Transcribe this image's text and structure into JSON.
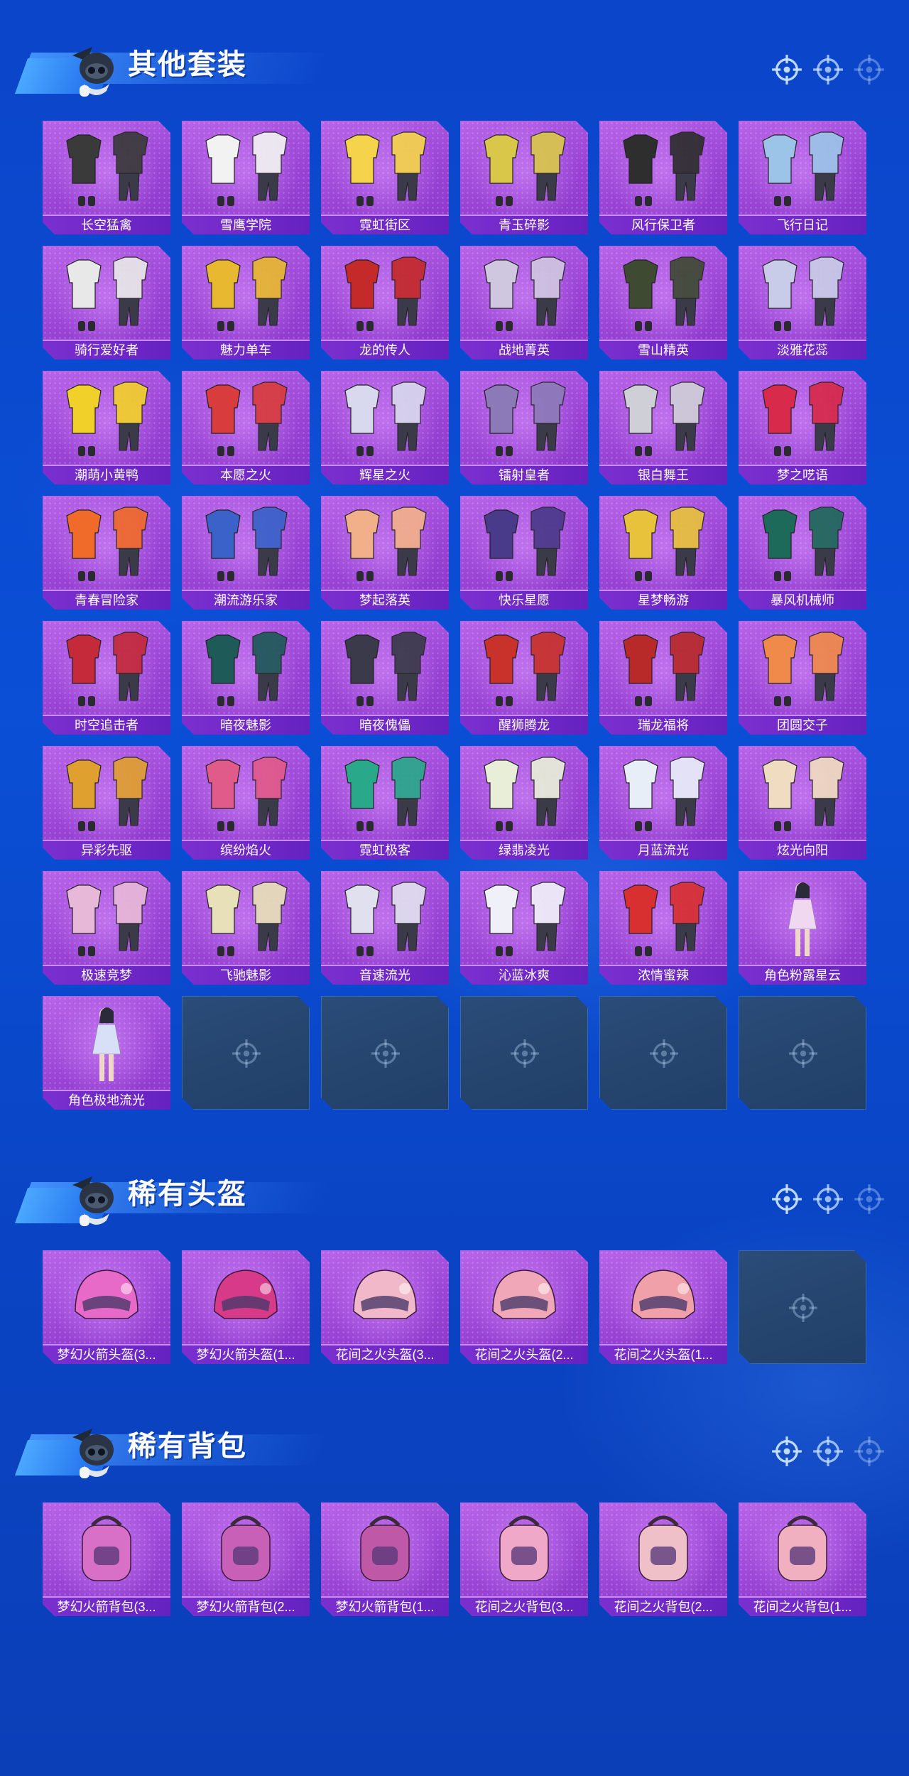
{
  "colors": {
    "background": "#0b45c9",
    "tile_purple": "#9a44d6",
    "label_purple": "#6522c0",
    "empty_tile": "#24436e"
  },
  "sections": [
    {
      "title": "其他套装",
      "items": [
        {
          "label": "长空猛禽",
          "icon": "outfit-icon",
          "art": "#3a3a3a"
        },
        {
          "label": "雪鹰学院",
          "icon": "outfit-icon",
          "art": "#f2f2f2"
        },
        {
          "label": "霓虹街区",
          "icon": "outfit-icon",
          "art": "#f5d34a"
        },
        {
          "label": "青玉碎影",
          "icon": "outfit-icon",
          "art": "#d9c74a"
        },
        {
          "label": "风行保卫者",
          "icon": "outfit-icon",
          "art": "#2e2e2e"
        },
        {
          "label": "飞行日记",
          "icon": "outfit-icon",
          "art": "#9cc4e8"
        },
        {
          "label": "骑行爱好者",
          "icon": "outfit-icon",
          "art": "#e8e8e8"
        },
        {
          "label": "魅力单车",
          "icon": "outfit-icon",
          "art": "#e8b830"
        },
        {
          "label": "龙的传人",
          "icon": "outfit-icon",
          "art": "#c42a2a"
        },
        {
          "label": "战地菁英",
          "icon": "outfit-icon",
          "art": "#cfc6e0"
        },
        {
          "label": "雪山精英",
          "icon": "outfit-icon",
          "art": "#3e4a32"
        },
        {
          "label": "淡雅花蕊",
          "icon": "outfit-icon",
          "art": "#c8cce8"
        },
        {
          "label": "潮萌小黄鸭",
          "icon": "outfit-icon",
          "art": "#f2d02a"
        },
        {
          "label": "本愿之火",
          "icon": "outfit-icon",
          "art": "#d83c3c"
        },
        {
          "label": "辉星之火",
          "icon": "outfit-icon",
          "art": "#d8d8ee"
        },
        {
          "label": "镭射皇者",
          "icon": "outfit-icon",
          "art": "#8c7ab8"
        },
        {
          "label": "银白舞王",
          "icon": "outfit-icon",
          "art": "#cfcfd8"
        },
        {
          "label": "梦之呓语",
          "icon": "outfit-icon",
          "art": "#d82a4a"
        },
        {
          "label": "青春冒险家",
          "icon": "outfit-icon",
          "art": "#f06a2a"
        },
        {
          "label": "潮流游乐家",
          "icon": "outfit-icon",
          "art": "#3a62c8"
        },
        {
          "label": "梦起落英",
          "icon": "outfit-icon",
          "art": "#f2b08a"
        },
        {
          "label": "快乐星愿",
          "icon": "outfit-icon",
          "art": "#4a3a8a"
        },
        {
          "label": "星梦畅游",
          "icon": "outfit-icon",
          "art": "#e8c23a"
        },
        {
          "label": "暴风机械师",
          "icon": "outfit-icon",
          "art": "#1e6a5a"
        },
        {
          "label": "时空追击者",
          "icon": "outfit-icon",
          "art": "#c42a3a"
        },
        {
          "label": "暗夜魅影",
          "icon": "outfit-icon",
          "art": "#1e5a58"
        },
        {
          "label": "暗夜傀儡",
          "icon": "outfit-icon",
          "art": "#3a3a4a"
        },
        {
          "label": "醒狮腾龙",
          "icon": "outfit-icon",
          "art": "#c8322a"
        },
        {
          "label": "瑞龙福将",
          "icon": "outfit-icon",
          "art": "#b82a2a"
        },
        {
          "label": "团圆交子",
          "icon": "outfit-icon",
          "art": "#f08a4a"
        },
        {
          "label": "异彩先驱",
          "icon": "outfit-icon",
          "art": "#e0a030"
        },
        {
          "label": "缤纷焰火",
          "icon": "outfit-icon",
          "art": "#e05a8a"
        },
        {
          "label": "霓虹极客",
          "icon": "outfit-icon",
          "art": "#2aa88a"
        },
        {
          "label": "绿翡凌光",
          "icon": "outfit-icon",
          "art": "#e8eed8"
        },
        {
          "label": "月蓝流光",
          "icon": "outfit-icon",
          "art": "#e8eef8"
        },
        {
          "label": "炫光向阳",
          "icon": "outfit-icon",
          "art": "#f0dcc0"
        },
        {
          "label": "极速竞梦",
          "icon": "outfit-icon",
          "art": "#e8b8d8"
        },
        {
          "label": "飞驰魅影",
          "icon": "outfit-icon",
          "art": "#e8e0b8"
        },
        {
          "label": "音速流光",
          "icon": "outfit-icon",
          "art": "#e0e0ee"
        },
        {
          "label": "沁蓝冰爽",
          "icon": "outfit-icon",
          "art": "#f0f0f8"
        },
        {
          "label": "浓情蜜辣",
          "icon": "outfit-icon",
          "art": "#d83030"
        },
        {
          "label": "角色粉露星云",
          "icon": "character-icon",
          "art": "#f0d8f0"
        },
        {
          "label": "角色极地流光",
          "icon": "character-icon",
          "art": "#d8e0f8"
        },
        null,
        null,
        null,
        null,
        null
      ]
    },
    {
      "title": "稀有头盔",
      "items": [
        {
          "label": "梦幻火箭头盔(3...",
          "icon": "helmet-icon",
          "art": "#e86ac8"
        },
        {
          "label": "梦幻火箭头盔(1...",
          "icon": "helmet-icon",
          "art": "#d83a8a"
        },
        {
          "label": "花间之火头盔(3...",
          "icon": "helmet-icon",
          "art": "#f0b8c8"
        },
        {
          "label": "花间之火头盔(2...",
          "icon": "helmet-icon",
          "art": "#f0a8b8"
        },
        {
          "label": "花间之火头盔(1...",
          "icon": "helmet-icon",
          "art": "#f0a0a8"
        },
        null
      ]
    },
    {
      "title": "稀有背包",
      "items": [
        {
          "label": "梦幻火箭背包(3...",
          "icon": "backpack-icon",
          "art": "#d870c8"
        },
        {
          "label": "梦幻火箭背包(2...",
          "icon": "backpack-icon",
          "art": "#c860b8"
        },
        {
          "label": "梦幻火箭背包(1...",
          "icon": "backpack-icon",
          "art": "#c058a8"
        },
        {
          "label": "花间之火背包(3...",
          "icon": "backpack-icon",
          "art": "#f0a8c8"
        },
        {
          "label": "花间之火背包(2...",
          "icon": "backpack-icon",
          "art": "#f0c0c8"
        },
        {
          "label": "花间之火背包(1...",
          "icon": "backpack-icon",
          "art": "#f0b0c0"
        }
      ]
    }
  ]
}
